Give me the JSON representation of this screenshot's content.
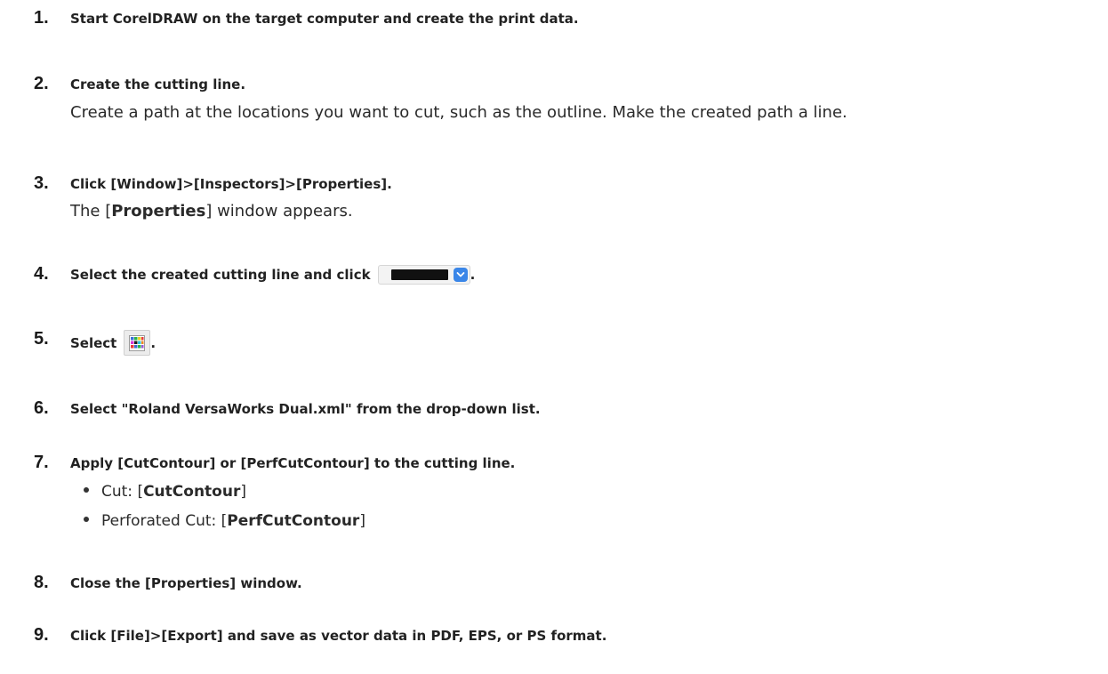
{
  "steps": [
    {
      "number": "1.",
      "heading": "Start CorelDRAW on the target computer and create the print data."
    },
    {
      "number": "2.",
      "heading": "Create the cutting line.",
      "description": "Create a path at the locations you want to cut, such as the outline. Make the created path a line."
    },
    {
      "number": "3.",
      "heading": "Click [Window]>[Inspectors]>[Properties].",
      "description_pre": "The [",
      "description_bold": "Properties",
      "description_post": "] window appears."
    },
    {
      "number": "4.",
      "heading_pre": "Select the created cutting line and click",
      "heading_post": ".",
      "control": {
        "swatch_color": "#111111",
        "button_color": "#3a86e8",
        "icon": "chevron-down-icon"
      }
    },
    {
      "number": "5.",
      "heading_pre": "Select",
      "heading_post": ".",
      "icon": "color-palette-icon"
    },
    {
      "number": "6.",
      "heading": "Select \"Roland VersaWorks Dual.xml\" from the drop-down list."
    },
    {
      "number": "7.",
      "heading": "Apply [CutContour] or [PerfCutContour] to the cutting line.",
      "bullets": [
        {
          "pre": "Cut: [",
          "bold": "CutContour",
          "post": "]"
        },
        {
          "pre": "Perforated Cut: [",
          "bold": "PerfCutContour",
          "post": "]"
        }
      ]
    },
    {
      "number": "8.",
      "heading": "Close the [Properties] window."
    },
    {
      "number": "9.",
      "heading": "Click [File]>[Export] and save as vector data in PDF, EPS, or PS format."
    }
  ]
}
